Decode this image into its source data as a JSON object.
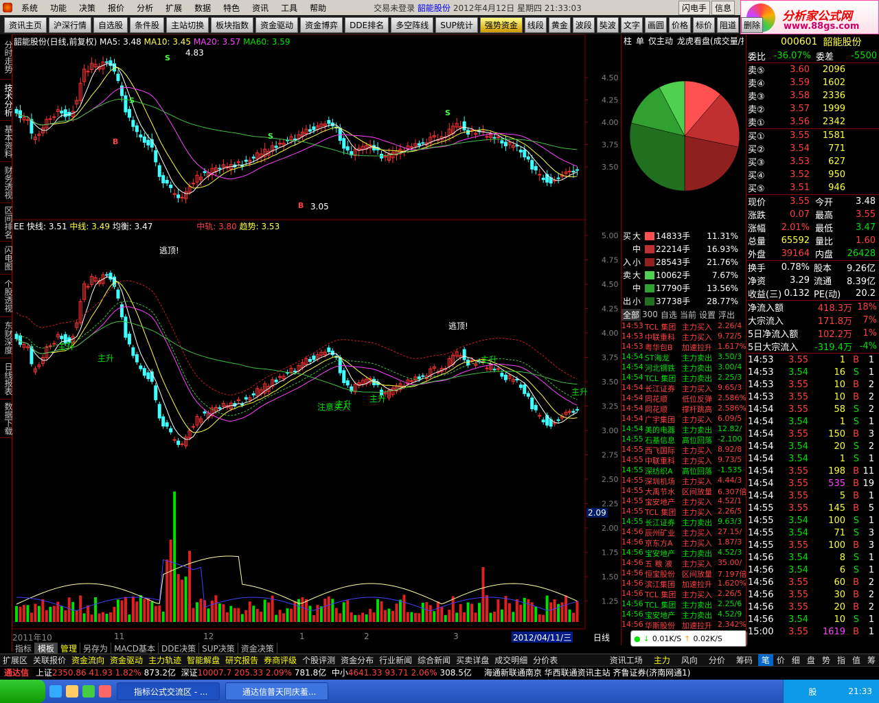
{
  "menu": {
    "items": [
      "系统",
      "功能",
      "决策",
      "报价",
      "分析",
      "扩展",
      "数据",
      "特色",
      "资讯",
      "工具",
      "帮助"
    ],
    "title_prefix": "交易未登录",
    "title_stock": "韶能股份",
    "title_date": "2012年4月12日 星期四 21:33:03",
    "buttons": [
      "闪电手",
      "信息"
    ]
  },
  "banner": {
    "line1": "分析家公式网",
    "line2": "www.88gs.com"
  },
  "toolbar": {
    "items": [
      "资讯主页",
      "沪深行情",
      "自选股",
      "条件股",
      "主站切换",
      "板块指数",
      "资金驱动",
      "资金博弈",
      "DDE排名",
      "多空阵线",
      "SUP统计",
      "强势资金"
    ],
    "active": "强势资金",
    "small": [
      "线段",
      "黄金",
      "波段",
      "奘波",
      "文字",
      "画圆",
      "价格",
      "标价",
      "阻道",
      "删除"
    ]
  },
  "lefttabs": [
    "分时走势",
    "技术分析",
    "基本资料",
    "财务透视",
    "区间排名",
    "闪电图",
    "个股透视",
    "东财深度",
    "日线报表",
    "数据下载"
  ],
  "main": {
    "name": "韶能股份(日线,前复权)",
    "ma5": "MA5: 3.48",
    "ma10": "MA10: 3.45",
    "ma20": "MA20: 3.57",
    "ma60": "MA60: 3.59",
    "high_label": "4.83",
    "low_label": "3.05",
    "price_ticks": [
      "4.50",
      "4.25",
      "4.00",
      "3.75",
      "3.50"
    ]
  },
  "ind": {
    "name": "EE",
    "fast": "快线: 3.51",
    "mid": "中线: 3.49",
    "bal": "均衡: 3.47",
    "zg": "中轨: 3.80",
    "trend": "趋势: 3.53",
    "ticks": [
      "5.00",
      "4.75",
      "4.50",
      "4.25",
      "4.00",
      "3.75",
      "3.50",
      "3.25",
      "3.00",
      "2.75",
      "2.50",
      "2.25",
      "2.00",
      "1.75",
      "1.50",
      "1.25"
    ],
    "escape1": "逃顶!",
    "escape2": "逃顶!",
    "rise_labels": [
      "主升",
      "主升",
      "主升",
      "主升",
      "主升",
      "主升"
    ],
    "buy_label": "注意买入"
  },
  "vol": {
    "value": "2.09"
  },
  "dates": [
    "2011年10",
    "11",
    "12",
    "1",
    "2",
    "3"
  ],
  "date_current": "2012/04/11/三",
  "period": "日线",
  "bottomtabs": [
    "指标",
    "模板",
    "管理",
    "另存为",
    "MACD基本",
    "DDE决策",
    "SUP决策",
    "资金决策"
  ],
  "bottomtabs_active": "模板",
  "sidebar": {
    "tabs": [
      "柱",
      "单",
      "仅主动",
      "龙虎看盘(成交量/技术)"
    ],
    "flow": [
      {
        "side": "买",
        "size": "大",
        "vol": "14833手",
        "pct": "11.31%"
      },
      {
        "side": "",
        "size": "中",
        "vol": "22214手",
        "pct": "16.93%"
      },
      {
        "side": "入",
        "size": "小",
        "vol": "28543手",
        "pct": "21.76%"
      },
      {
        "side": "卖",
        "size": "大",
        "vol": "10062手",
        "pct": "7.67%"
      },
      {
        "side": "",
        "size": "中",
        "vol": "17790手",
        "pct": "13.56%"
      },
      {
        "side": "出",
        "size": "小",
        "vol": "37738手",
        "pct": "28.77%"
      }
    ],
    "filter_tabs": [
      "全部",
      "300",
      "自选",
      "当前",
      "设置",
      "浮出"
    ],
    "news": [
      {
        "time": "14:53",
        "name": "TCL 集团",
        "action": "主力买入",
        "val": "2.26/4",
        "c": "red"
      },
      {
        "time": "14:53",
        "name": "中联重科",
        "action": "主力买入",
        "val": "9.72/5",
        "c": "red"
      },
      {
        "time": "14:53",
        "name": "粤华包B",
        "action": "加速拉升",
        "val": "1.617%",
        "c": "red"
      },
      {
        "time": "14:54",
        "name": "ST海龙",
        "action": "主力卖出",
        "val": "3.50/3",
        "c": "grn"
      },
      {
        "time": "14:54",
        "name": "河北钢铁",
        "action": "主力卖出",
        "val": "3.00/4",
        "c": "grn"
      },
      {
        "time": "14:54",
        "name": "TCL 集团",
        "action": "主力卖出",
        "val": "2.25/3",
        "c": "grn"
      },
      {
        "time": "14:54",
        "name": "长江证券",
        "action": "主力买入",
        "val": "9.65/3",
        "c": "red"
      },
      {
        "time": "14:54",
        "name": "同花顺",
        "action": "低位反弹",
        "val": "2.586%",
        "c": "red"
      },
      {
        "time": "14:54",
        "name": "同花顺",
        "action": "撑杆跳高",
        "val": "2.586%",
        "c": "red"
      },
      {
        "time": "14:54",
        "name": "广宇集团",
        "action": "主力买入",
        "val": "6.09/5",
        "c": "red"
      },
      {
        "time": "14:54",
        "name": "美的电器",
        "action": "主力卖出",
        "val": "12.82/",
        "c": "grn"
      },
      {
        "time": "14:55",
        "name": "石基信息",
        "action": "高位回落",
        "val": "-2.100",
        "c": "grn"
      },
      {
        "time": "14:55",
        "name": "西飞国际",
        "action": "主力买入",
        "val": "8.92/8",
        "c": "red"
      },
      {
        "time": "14:55",
        "name": "中联重科",
        "action": "主力买入",
        "val": "9.73/5",
        "c": "red"
      },
      {
        "time": "14:55",
        "name": "深纺织A",
        "action": "高位回落",
        "val": "-1.535",
        "c": "grn"
      },
      {
        "time": "14:55",
        "name": "深圳机场",
        "action": "主力买入",
        "val": "4.44/3",
        "c": "red"
      },
      {
        "time": "14:55",
        "name": "大禹节水",
        "action": "区间放量",
        "val": "6.307倍",
        "c": "red"
      },
      {
        "time": "14:55",
        "name": "宝安地产",
        "action": "主力买入",
        "val": "4.52/1",
        "c": "red"
      },
      {
        "time": "14:55",
        "name": "TCL 集团",
        "action": "主力买入",
        "val": "2.26/5",
        "c": "red"
      },
      {
        "time": "14:55",
        "name": "长江证券",
        "action": "主力卖出",
        "val": "9.63/3",
        "c": "grn"
      },
      {
        "time": "14:56",
        "name": "辰州矿业",
        "action": "主力买入",
        "val": "27.15/",
        "c": "red"
      },
      {
        "time": "14:56",
        "name": "京东方A",
        "action": "主力买入",
        "val": "1.87/3",
        "c": "red"
      },
      {
        "time": "14:56",
        "name": "宝安地产",
        "action": "主力卖出",
        "val": "4.52/3",
        "c": "grn"
      },
      {
        "time": "14:56",
        "name": "五 粮 液",
        "action": "主力买入",
        "val": "35.00/",
        "c": "red"
      },
      {
        "time": "14:56",
        "name": "恒宝股份",
        "action": "区间放量",
        "val": "7.197倍",
        "c": "red"
      },
      {
        "time": "14:56",
        "name": "滨江集团",
        "action": "加速拉升",
        "val": "1.620%",
        "c": "red"
      },
      {
        "time": "14:56",
        "name": "TCL 集团",
        "action": "主力买入",
        "val": "2.26/5",
        "c": "red"
      },
      {
        "time": "14:56",
        "name": "TCL 集团",
        "action": "主力卖出",
        "val": "2.25/6",
        "c": "grn"
      },
      {
        "time": "14:56",
        "name": "宝安地产",
        "action": "主力卖出",
        "val": "4.52/9",
        "c": "grn"
      },
      {
        "time": "14:56",
        "name": "华斯股份",
        "action": "加速拉升",
        "val": "2.342%",
        "c": "red"
      }
    ],
    "net": {
      "down": "0.01K/S",
      "up": "0.02K/S"
    }
  },
  "right": {
    "code": "000601",
    "name": "韶能股份",
    "wb": "-36.07%",
    "wc": "-5500",
    "asks": [
      {
        "l": "卖⑤",
        "p": "3.60",
        "v": "2096"
      },
      {
        "l": "卖④",
        "p": "3.59",
        "v": "1602"
      },
      {
        "l": "卖③",
        "p": "3.58",
        "v": "2336"
      },
      {
        "l": "卖②",
        "p": "3.57",
        "v": "1999"
      },
      {
        "l": "卖①",
        "p": "3.56",
        "v": "2342"
      }
    ],
    "bids": [
      {
        "l": "买①",
        "p": "3.55",
        "v": "1581"
      },
      {
        "l": "买②",
        "p": "3.54",
        "v": "771"
      },
      {
        "l": "买③",
        "p": "3.53",
        "v": "627"
      },
      {
        "l": "买④",
        "p": "3.52",
        "v": "950"
      },
      {
        "l": "买⑤",
        "p": "3.51",
        "v": "946"
      }
    ],
    "stats": [
      {
        "a": "现价",
        "av": "3.55",
        "ac": "red",
        "b": "今开",
        "bv": "3.48",
        "bc": "wht"
      },
      {
        "a": "涨跌",
        "av": "0.07",
        "ac": "red",
        "b": "最高",
        "bv": "3.55",
        "bc": "red"
      },
      {
        "a": "涨幅",
        "av": "2.01%",
        "ac": "red",
        "b": "最低",
        "bv": "3.47",
        "bc": "grn"
      },
      {
        "a": "总量",
        "av": "65592",
        "ac": "yel",
        "b": "量比",
        "bv": "1.60",
        "bc": "red"
      },
      {
        "a": "外盘",
        "av": "39164",
        "ac": "red",
        "b": "内盘",
        "bv": "26428",
        "bc": "grn"
      }
    ],
    "stats2": [
      {
        "a": "换手",
        "av": "0.78%",
        "b": "股本",
        "bv": "9.26亿"
      },
      {
        "a": "净资",
        "av": "3.29",
        "b": "流通",
        "bv": "8.39亿"
      },
      {
        "a": "收益(三)",
        "av": "0.132",
        "b": "PE(动)",
        "bv": "20.2"
      }
    ],
    "flows": [
      {
        "l": "净流入额",
        "v": "418.3万",
        "p": "18%",
        "c": "red"
      },
      {
        "l": "大宗流入",
        "v": "171.8万",
        "p": "7%",
        "c": "red"
      },
      {
        "l": "5日净流入额",
        "v": "102.2万",
        "p": "1%",
        "c": "red"
      },
      {
        "l": "5日大宗流入",
        "v": "-319.4万",
        "p": "-4%",
        "c": "grn"
      }
    ],
    "ticks": [
      {
        "t": "14:53",
        "p": "3.55",
        "v": "1",
        "s": "B",
        "n": "1"
      },
      {
        "t": "14:53",
        "p": "3.54",
        "v": "16",
        "s": "S",
        "n": "1"
      },
      {
        "t": "14:53",
        "p": "3.55",
        "v": "10",
        "s": "B",
        "n": "2"
      },
      {
        "t": "14:53",
        "p": "3.55",
        "v": "10",
        "s": "B",
        "n": "2"
      },
      {
        "t": "14:54",
        "p": "3.55",
        "v": "58",
        "s": "S",
        "n": "2"
      },
      {
        "t": "14:54",
        "p": "3.54",
        "v": "1",
        "s": "S",
        "n": "1"
      },
      {
        "t": "14:54",
        "p": "3.55",
        "v": "150",
        "s": "B",
        "n": "3"
      },
      {
        "t": "14:54",
        "p": "3.54",
        "v": "20",
        "s": "S",
        "n": "2"
      },
      {
        "t": "14:54",
        "p": "3.54",
        "v": "1",
        "s": "S",
        "n": "1"
      },
      {
        "t": "14:54",
        "p": "3.55",
        "v": "198",
        "s": "B",
        "n": "11"
      },
      {
        "t": "14:54",
        "p": "3.55",
        "v": "535",
        "s": "B",
        "n": "19"
      },
      {
        "t": "14:54",
        "p": "3.55",
        "v": "5",
        "s": "B",
        "n": "1"
      },
      {
        "t": "14:55",
        "p": "3.55",
        "v": "145",
        "s": "B",
        "n": "5"
      },
      {
        "t": "14:55",
        "p": "3.54",
        "v": "100",
        "s": "S",
        "n": "1"
      },
      {
        "t": "14:55",
        "p": "3.54",
        "v": "71",
        "s": "S",
        "n": "3"
      },
      {
        "t": "14:55",
        "p": "3.55",
        "v": "100",
        "s": "B",
        "n": "3"
      },
      {
        "t": "14:56",
        "p": "3.54",
        "v": "8",
        "s": "S",
        "n": "1"
      },
      {
        "t": "14:56",
        "p": "3.54",
        "v": "6",
        "s": "S",
        "n": "1"
      },
      {
        "t": "14:56",
        "p": "3.55",
        "v": "60",
        "s": "B",
        "n": "2"
      },
      {
        "t": "14:56",
        "p": "3.55",
        "v": "30",
        "s": "B",
        "n": "2"
      },
      {
        "t": "14:56",
        "p": "3.55",
        "v": "20",
        "s": "B",
        "n": "2"
      },
      {
        "t": "14:56",
        "p": "3.54",
        "v": "10",
        "s": "S",
        "n": "1"
      },
      {
        "t": "15:00",
        "p": "3.55",
        "v": "1619",
        "s": "B",
        "n": "1"
      }
    ],
    "tabs": [
      "笔",
      "价",
      "细",
      "盘",
      "势",
      "指",
      "值",
      "筹"
    ]
  },
  "tabbar2": [
    "扩展区",
    "关联报价",
    "资金流向",
    "资金驱动",
    "主力轨迹",
    "智能解盘",
    "研究报告",
    "券商评级",
    "个股评测",
    "资金分布",
    "行业新闻",
    "综合新闻",
    "买卖详盘",
    "成交明细",
    "分价表"
  ],
  "tabbar2_right": [
    "资讯工场",
    "主力",
    "风向",
    "分价",
    "筹码"
  ],
  "status": {
    "brand": "通达信",
    "sh": "上证",
    "sh_v": "2350.86",
    "sh_c": "41.93",
    "sh_p": "1.82%",
    "sh_a": "873.2亿",
    "sz": "深证",
    "sz_v": "10007.7",
    "sz_c": "205.33",
    "sz_p": "2.09%",
    "sz_a": "781.8亿",
    "zx": "中小",
    "zx_v": "4641.33",
    "zx_c": "93.71",
    "zx_p": "2.06%",
    "zx_a": "308.5亿",
    "info": "海通新联通南京 华西联通资讯主站 齐鲁证券(济南网通1)"
  },
  "taskbar": {
    "tasks": [
      "指标公式交流区 - ...",
      "通达信普天同庆羞..."
    ],
    "clock": "21:33",
    "ime": "股"
  },
  "colors": {
    "up": "#ff4040",
    "down": "#00e000",
    "ma5": "#ffffff",
    "ma10": "#ffff40",
    "ma20": "#ff40ff",
    "ma60": "#40c040"
  }
}
